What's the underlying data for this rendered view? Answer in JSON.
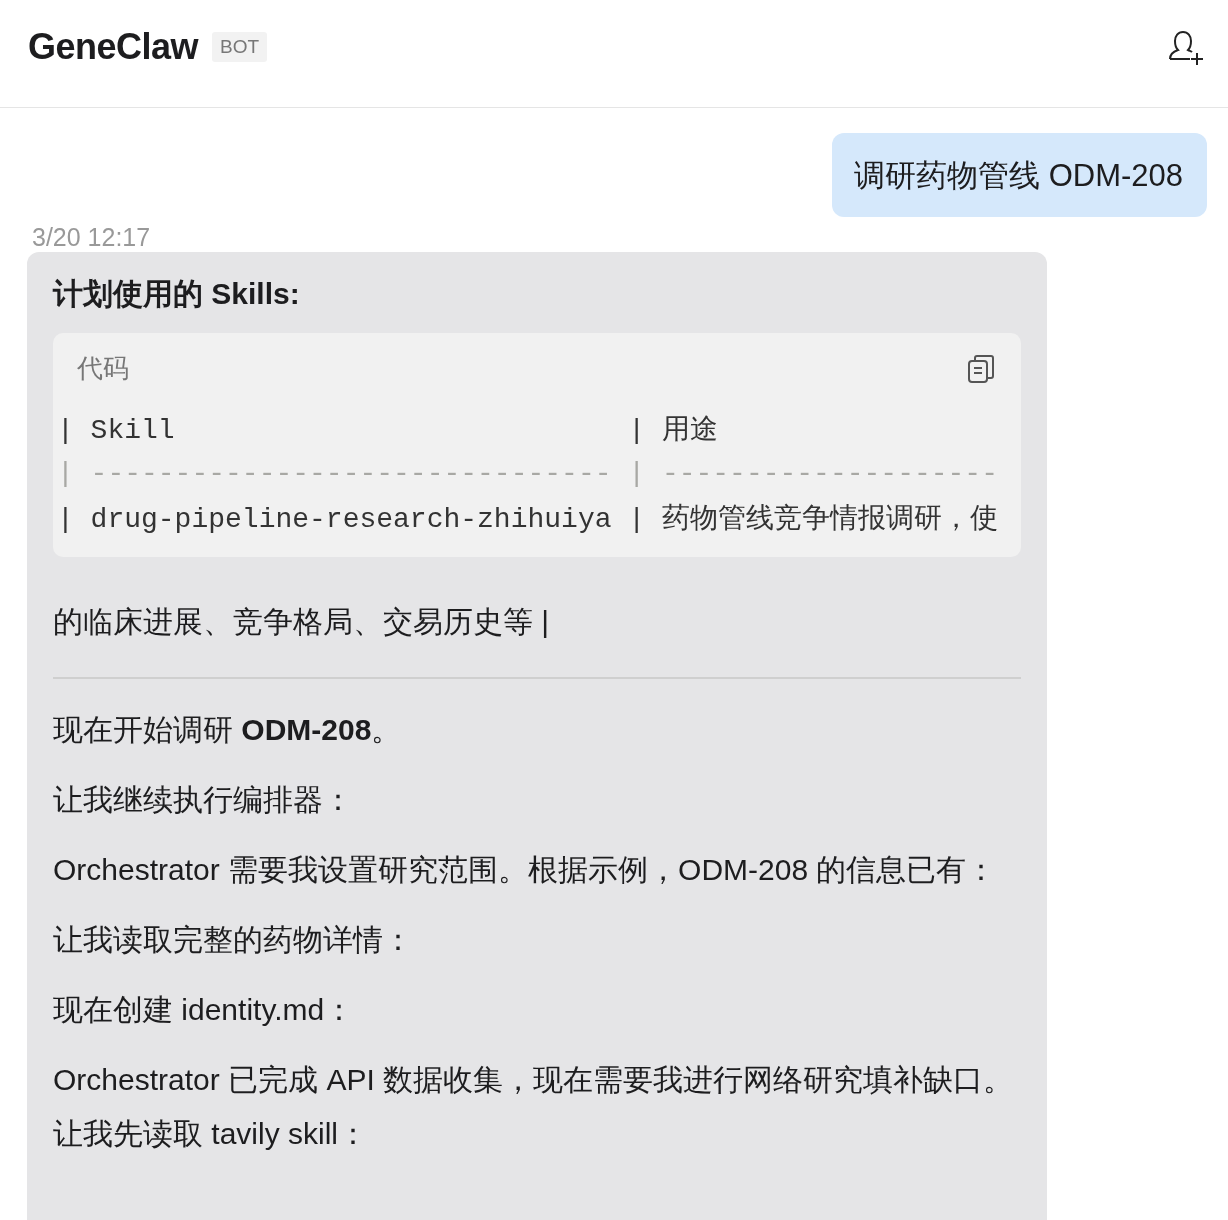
{
  "header": {
    "title": "GeneClaw",
    "badge": "BOT"
  },
  "user_message": {
    "text": "调研药物管线 ODM-208"
  },
  "bot_message": {
    "timestamp": "3/20 12:17",
    "heading": "计划使用的 Skills:",
    "code_block": {
      "label": "代码",
      "lines": [
        {
          "kind": "text",
          "text": "| Skill                           | 用途"
        },
        {
          "kind": "rule",
          "text": "| ------------------------------- | --------------------"
        },
        {
          "kind": "text",
          "text": "| drug-pipeline-research-zhihuiya | 药物管线竞争情报调研，使"
        }
      ]
    },
    "continuation": "的临床进展、竞争格局、交易历史等 |",
    "paragraphs": [
      "现在开始调研 **ODM-208**。",
      "让我继续执行编排器：",
      "Orchestrator 需要我设置研究范围。根据示例，ODM-208 的信息已有：",
      "让我读取完整的药物详情：",
      "现在创建 identity.md：",
      "Orchestrator 已完成 API 数据收集，现在需要我进行网络研究填补缺口。让我先读取 tavily skill："
    ]
  }
}
